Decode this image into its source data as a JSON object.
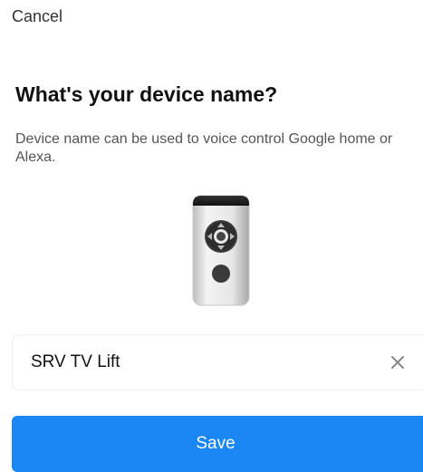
{
  "header": {
    "cancel_label": "Cancel"
  },
  "main": {
    "title": "What's your device name?",
    "description": "Device name can be used to voice control Google home or Alexa.",
    "illustration_icon": "tv-remote-icon",
    "name_field": {
      "value": "SRV TV Lift",
      "placeholder": ""
    },
    "clear_icon": "close-icon"
  },
  "footer": {
    "save_label": "Save"
  },
  "colors": {
    "accent": "#1a87f4",
    "title": "#111111",
    "body_text": "#555555"
  }
}
